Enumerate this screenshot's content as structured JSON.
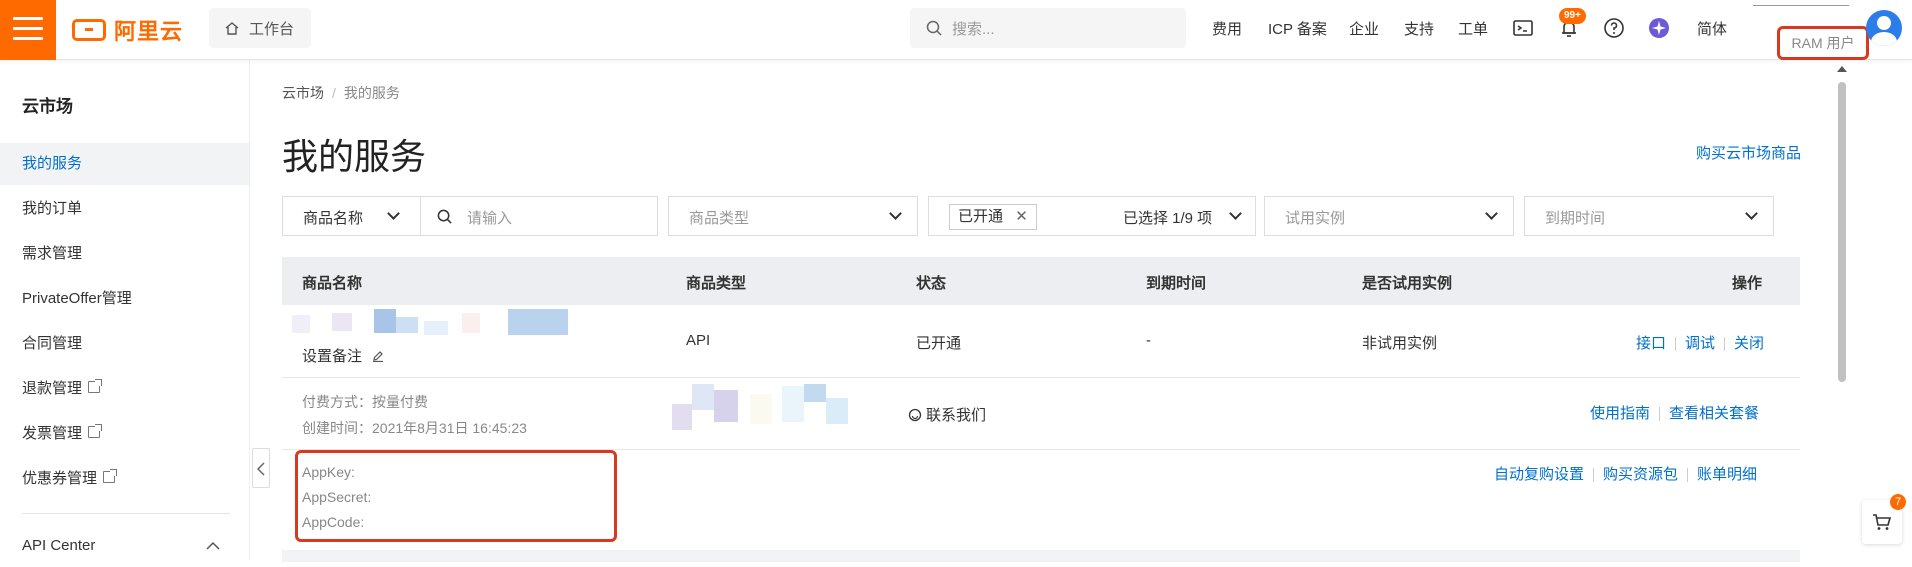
{
  "topbar": {
    "logo_text": "阿里云",
    "workbench_label": "工作台",
    "search_placeholder": "搜索...",
    "nav": [
      "费用",
      "ICP 备案",
      "企业",
      "支持",
      "工单"
    ],
    "notification_badge": "99+",
    "language": "简体",
    "ram_user": "RAM 用户"
  },
  "sidebar": {
    "title": "云市场",
    "items": [
      {
        "label": "我的服务",
        "active": true
      },
      {
        "label": "我的订单"
      },
      {
        "label": "需求管理"
      },
      {
        "label": "PrivateOffer管理"
      },
      {
        "label": "合同管理"
      },
      {
        "label": "退款管理"
      },
      {
        "label": "发票管理"
      },
      {
        "label": "优惠券管理"
      },
      {
        "label": "API Center"
      }
    ]
  },
  "main": {
    "breadcrumb": [
      "云市场",
      "我的服务"
    ],
    "title": "我的服务",
    "buy_link": "购买云市场商品",
    "filters": {
      "product_name_select": "商品名称",
      "search_placeholder": "请输入",
      "product_type": "商品类型",
      "status_tag": "已开通",
      "status_selected": "已选择 1/9 项",
      "trial_instance": "试用实例",
      "expire_time": "到期时间"
    },
    "table": {
      "headers": [
        "商品名称",
        "商品类型",
        "状态",
        "到期时间",
        "是否试用实例",
        "操作"
      ],
      "row": {
        "remark": "设置备注",
        "type": "API",
        "status": "已开通",
        "expire": "-",
        "trial": "非试用实例",
        "actions": [
          "接口",
          "调试",
          "关闭"
        ]
      },
      "detail": {
        "pay_method": "付费方式：按量付费",
        "created": "创建时间：2021年8月31日 16:45:23",
        "contact": "联系我们",
        "actions": [
          "使用指南",
          "查看相关套餐"
        ]
      },
      "keys": {
        "app_key": "AppKey:",
        "app_secret": "AppSecret:",
        "app_code": "AppCode:",
        "actions": [
          "自动复购设置",
          "购买资源包",
          "账单明细"
        ]
      }
    }
  },
  "cart_badge": "7",
  "colors": {
    "brand": "#ff6a00",
    "link": "#0070cc",
    "highlight": "#d9371f"
  }
}
